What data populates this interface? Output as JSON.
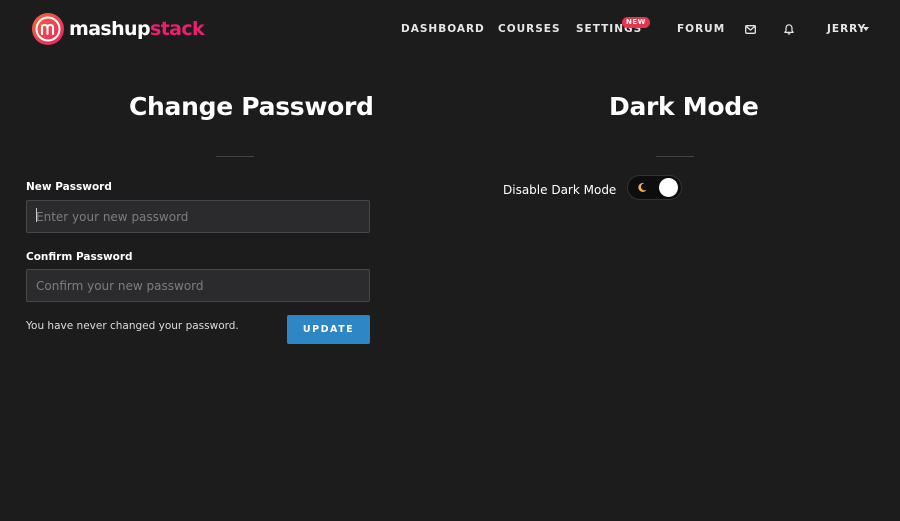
{
  "header": {
    "logo": {
      "word1": "mashup",
      "word2": "stack"
    },
    "nav": {
      "dashboard": "DASHBOARD",
      "courses": "COURSES",
      "settings": "SETTINGS",
      "settings_badge": "NEW",
      "forum": "FORUM",
      "user": "JERRY"
    },
    "icons": [
      "mail-icon",
      "bell-icon",
      "chevron-down-icon"
    ]
  },
  "password_section": {
    "title": "Change Password",
    "new_label": "New Password",
    "new_placeholder": "Enter your new password",
    "confirm_label": "Confirm Password",
    "confirm_placeholder": "Confirm your new password",
    "note": "You have never changed your password.",
    "button": "UPDATE"
  },
  "dark_mode_section": {
    "title": "Dark Mode",
    "toggle_label": "Disable Dark Mode",
    "toggle_on": true,
    "toggle_icon": "moon-icon"
  },
  "colors": {
    "background": "#1c1c1d",
    "brand_pink": "#ec1f6e",
    "badge_red": "#e8334a",
    "button_blue": "#2f86c5",
    "moon_yellow": "#f5b83d"
  }
}
